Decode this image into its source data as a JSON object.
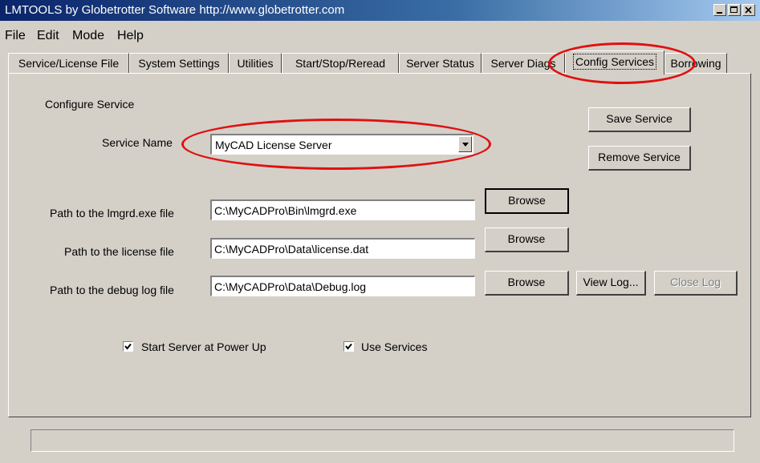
{
  "window": {
    "title": "LMTOOLS by Globetrotter Software http://www.globetrotter.com"
  },
  "menu": [
    "File",
    "Edit",
    "Mode",
    "Help"
  ],
  "tabs": [
    {
      "label": "Service/License File"
    },
    {
      "label": "System Settings"
    },
    {
      "label": "Utilities"
    },
    {
      "label": "Start/Stop/Reread"
    },
    {
      "label": "Server Status"
    },
    {
      "label": "Server Diags"
    },
    {
      "label": "Config Services",
      "active": true
    },
    {
      "label": "Borrowing"
    }
  ],
  "config": {
    "section_label": "Configure Service",
    "service_name_label": "Service Name",
    "service_name_value": "MyCAD License Server",
    "lmgrd_label": "Path to the lmgrd.exe file",
    "lmgrd_value": "C:\\MyCADPro\\Bin\\lmgrd.exe",
    "license_label": "Path to the license file",
    "license_value": "C:\\MyCADPro\\Data\\license.dat",
    "debug_label": "Path to the debug log file",
    "debug_value": "C:\\MyCADPro\\Data\\Debug.log",
    "save_service": "Save Service",
    "remove_service": "Remove Service",
    "browse": "Browse",
    "view_log": "View Log...",
    "close_log": "Close Log",
    "start_at_powerup": {
      "label": "Start Server at Power Up",
      "checked": true
    },
    "use_services": {
      "label": "Use Services",
      "checked": true
    }
  },
  "status": {
    "text": ""
  },
  "colors": {
    "highlight_ellipse": "#e01010",
    "title_start": "#0a246a",
    "title_end": "#a6caf0"
  }
}
